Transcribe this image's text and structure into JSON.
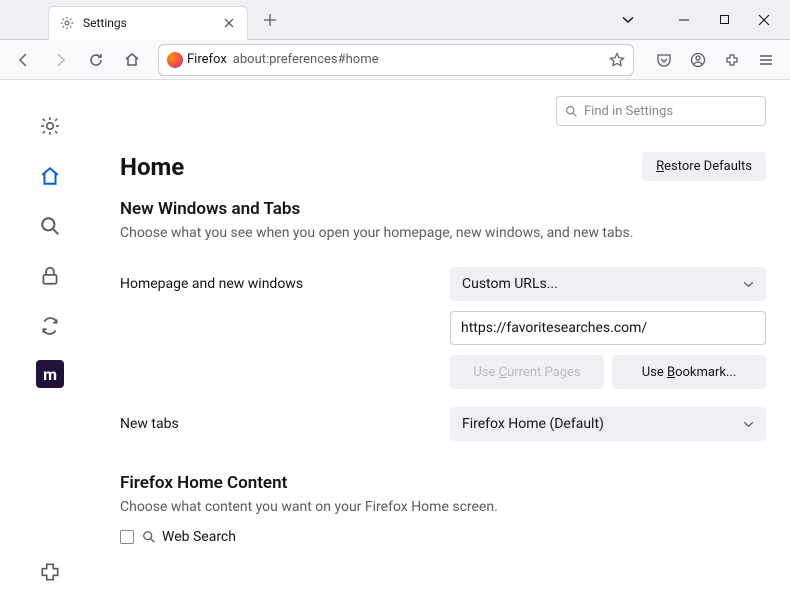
{
  "tab": {
    "title": "Settings"
  },
  "url": {
    "brand": "Firefox",
    "path": "about:preferences#home"
  },
  "search": {
    "placeholder": "Find in Settings"
  },
  "page": {
    "heading": "Home",
    "restore": "estore Defaults",
    "restore_prefix": "R"
  },
  "section1": {
    "title": "New Windows and Tabs",
    "desc": "Choose what you see when you open your homepage, new windows, and new tabs."
  },
  "homepage": {
    "label": "Homepage and new windows",
    "select": "Custom URLs...",
    "url": "https://favoritesearches.com/",
    "use_current_prefix": "Use ",
    "use_current_ul": "C",
    "use_current_suffix": "urrent Pages",
    "use_bookmark_prefix": "Use ",
    "use_bookmark_ul": "B",
    "use_bookmark_suffix": "ookmark..."
  },
  "newtabs": {
    "label": "New tabs",
    "select": "Firefox Home (Default)"
  },
  "section2": {
    "title": "Firefox Home Content",
    "desc": "Choose what content you want on your Firefox Home screen.",
    "checkbox1": "Web Search"
  },
  "sidebar_ext": "m"
}
